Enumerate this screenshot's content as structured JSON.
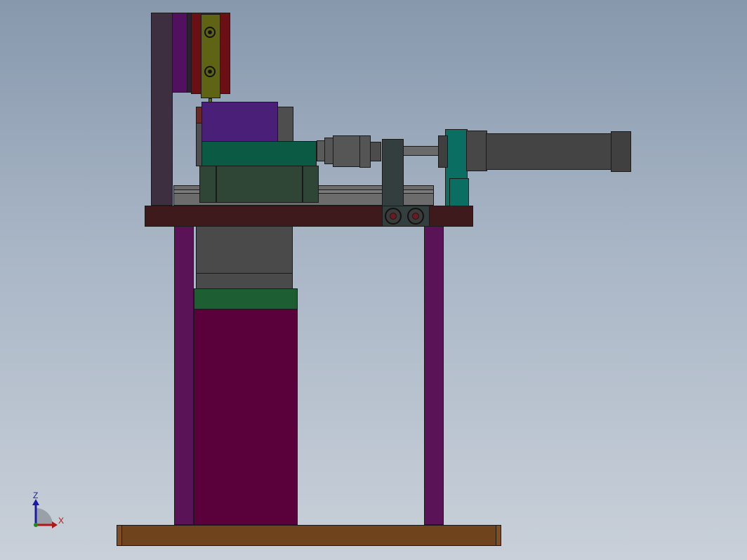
{
  "viewport": {
    "background_top": "#8798ad",
    "background_bottom": "#c9d0d9"
  },
  "triad": {
    "z_label": "Z",
    "x_label": "X",
    "z_color": "#1a1aa8",
    "x_color": "#b01818"
  },
  "colors": {
    "base_plate": "#6f431c",
    "legs": "#5a1356",
    "table_top": "#3e1a1d",
    "motor_body": "#5a003b",
    "motor_ring": "#1e5e33",
    "gearbox": "#4a4a4a",
    "slide_rail": "#6c6c6c",
    "slide_block": "#2f4536",
    "carriage": "#0b5a43",
    "carriage_top": "#4a1f78",
    "column": "#3d2f40",
    "clamp_plate": "#52115e",
    "clamp_bar": "#6a0f14",
    "clamp_arm": "#5e6413",
    "cylinder": "#444444",
    "cylinder_mount": "#0b6e63",
    "bracket": "#333f3e"
  }
}
